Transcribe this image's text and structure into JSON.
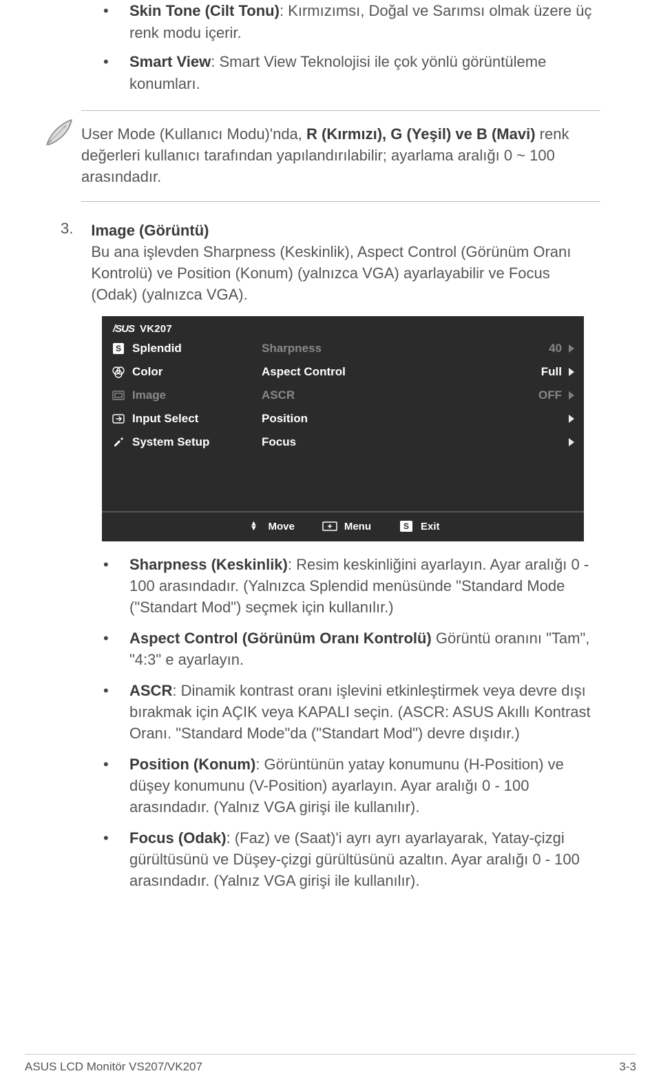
{
  "top_bullets": [
    {
      "b": "Skin Tone (Cilt Tonu)",
      "t": ": Kırmızımsı, Doğal ve Sarımsı olmak üzere üç renk modu içerir."
    },
    {
      "b": "Smart View",
      "t": ": Smart View Teknolojisi ile çok yönlü görüntüleme konumları."
    }
  ],
  "note": {
    "pre": "User Mode (Kullanıcı Modu)'nda, ",
    "bold": "R (Kırmızı), G (Yeşil) ve B (Mavi)",
    "post": " renk değerleri kullanıcı tarafından yapılandırılabilir; ayarlama aralığı 0 ~ 100 arasındadır."
  },
  "sec3": {
    "num": "3.",
    "title": "Image (Görüntü)",
    "body": "Bu ana işlevden Sharpness (Keskinlik), Aspect Control (Görünüm Oranı Kontrolü) ve Position (Konum) (yalnızca VGA) ayarlayabilir ve Focus (Odak) (yalnızca VGA)."
  },
  "osd": {
    "model": "VK207",
    "left": [
      {
        "icon": "S",
        "label": "Splendid"
      },
      {
        "icon": "rgb",
        "label": "Color"
      },
      {
        "icon": "img",
        "label": "Image",
        "sel": true
      },
      {
        "icon": "inp",
        "label": "Input Select"
      },
      {
        "icon": "sys",
        "label": "System Setup"
      }
    ],
    "right": [
      {
        "label": "Sharpness",
        "val": "40",
        "white": false
      },
      {
        "label": "Aspect Control",
        "val": "Full",
        "white": true
      },
      {
        "label": "ASCR",
        "val": "OFF",
        "white": false
      },
      {
        "label": "Position",
        "val": "",
        "white": true
      },
      {
        "label": "Focus",
        "val": "",
        "white": true
      }
    ],
    "foot": {
      "move": "Move",
      "menu": "Menu",
      "exit": "Exit"
    }
  },
  "lower": [
    {
      "b": "Sharpness (Keskinlik)",
      "t": ": Resim keskinliğini ayarlayın. Ayar aralığı 0 - 100 arasındadır. (Yalnızca Splendid menüsünde \"Standard Mode (\"Standart Mod\") seçmek için kullanılır.)"
    },
    {
      "b": "Aspect Control (Görünüm Oranı Kontrolü)",
      "t": " Görüntü oranını \"Tam\", \"4:3\" e ayarlayın."
    },
    {
      "b": "ASCR",
      "t": ": Dinamik kontrast oranı işlevini etkinleştirmek veya devre dışı bırakmak için AÇIK veya KAPALI seçin. (ASCR: ASUS Akıllı Kontrast Oranı. \"Standard Mode\"da (\"Standart Mod\") devre dışıdır.)"
    },
    {
      "b": "Position (Konum)",
      "t": ": Görüntünün yatay konumunu (H-Position) ve düşey konumunu (V-Position) ayarlayın. Ayar aralığı 0 - 100 arasındadır. (Yalnız VGA girişi ile kullanılır)."
    },
    {
      "b": "Focus (Odak)",
      "t": ": (Faz) ve (Saat)'i ayrı ayrı ayarlayarak, Yatay-çizgi gürültüsünü ve Düşey-çizgi gürültüsünü azaltın. Ayar aralığı 0 - 100 arasındadır. (Yalnız VGA girişi ile kullanılır)."
    }
  ],
  "footer": {
    "left": "ASUS LCD Monitör VS207/VK207",
    "right": "3-3"
  }
}
